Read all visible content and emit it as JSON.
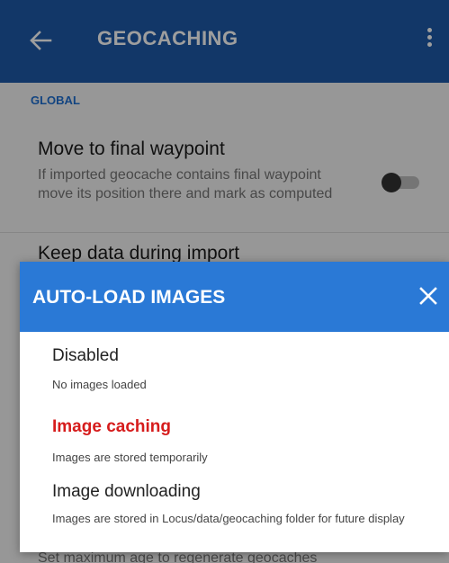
{
  "appbar": {
    "title": "GEOCACHING",
    "back_icon": "arrow-left-icon",
    "more_icon": "more-vertical-icon"
  },
  "settings": {
    "section_label": "GLOBAL",
    "items": [
      {
        "title": "Move to final waypoint",
        "description": "If imported geocache contains final waypoint move its position there and mark as computed",
        "toggle_on": false
      },
      {
        "title": "Keep data during import"
      }
    ],
    "bottom_peek": "Set maximum age to regenerate geocaches"
  },
  "dialog": {
    "title": "AUTO-LOAD IMAGES",
    "close_icon": "close-icon",
    "options": [
      {
        "label": "Disabled",
        "description": "No images loaded",
        "selected": false
      },
      {
        "label": "Image caching",
        "description": "Images are stored temporarily",
        "selected": true
      },
      {
        "label": "Image downloading",
        "description": "Images are stored in Locus/data/geocaching folder for future display",
        "selected": false
      }
    ]
  },
  "colors": {
    "appbar": "#1d5aa8",
    "dialog_header": "#2a79d6",
    "accent": "#1e6fd0",
    "selected_option": "#d61c1c"
  }
}
